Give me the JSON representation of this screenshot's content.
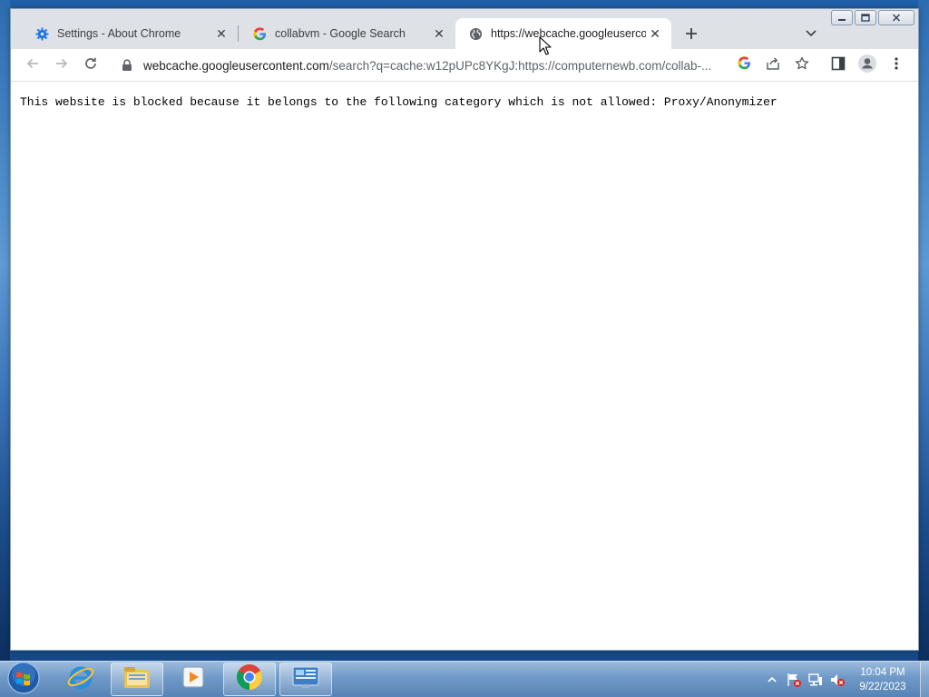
{
  "browser": {
    "tabs": [
      {
        "title": "Settings - About Chrome",
        "icon": "gear-icon",
        "active": false
      },
      {
        "title": "collabvm - Google Search",
        "icon": "google-g-icon",
        "active": false
      },
      {
        "title": "https://webcache.googleusercon",
        "icon": "globe-icon",
        "active": true
      }
    ],
    "address": {
      "host": "webcache.googleusercontent.com",
      "path": "/search?q=cache:w12pUPc8YKgJ:https://computernewb.com/collab-..."
    }
  },
  "page": {
    "message": "This website is blocked because it belongs to the following category which is not allowed: Proxy/Anonymizer"
  },
  "taskbar": {
    "items": [
      "start-orb",
      "internet-explorer-icon",
      "file-explorer-icon",
      "media-player-icon",
      "chrome-icon",
      "control-panel-icon"
    ],
    "clock": {
      "time": "10:04 PM",
      "date": "9/22/2023"
    }
  },
  "colors": {
    "tabstrip": "#dee1e6",
    "chrome_blue": "#1a73e8",
    "taskbar": "#7aa3cf"
  }
}
